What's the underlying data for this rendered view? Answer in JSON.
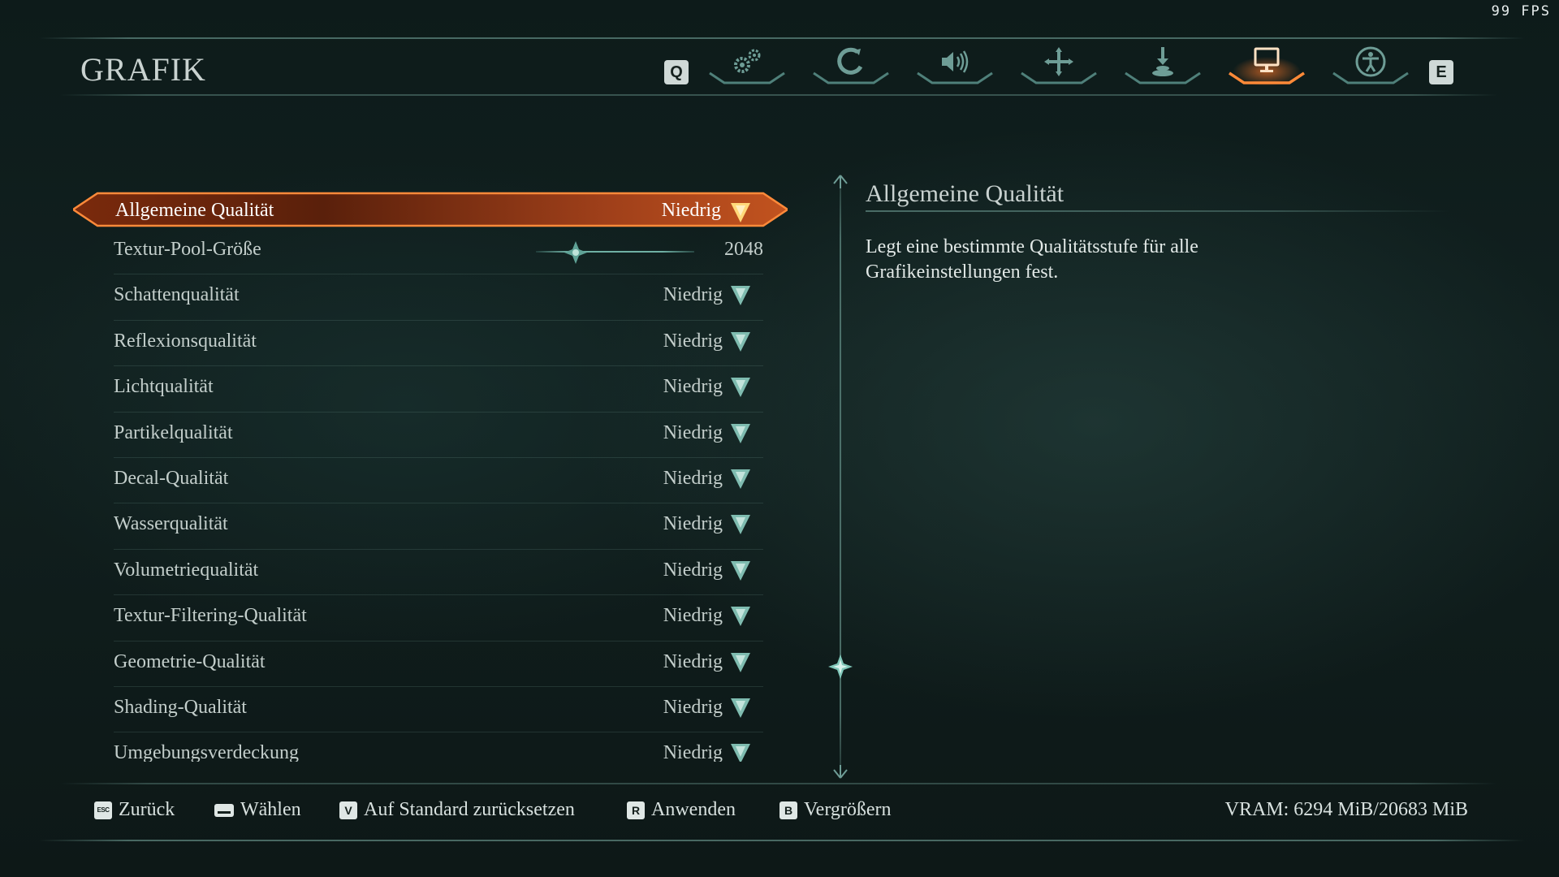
{
  "overlay": {
    "fps": "99 FPS"
  },
  "header": {
    "title": "GRAFIK",
    "prev_tab_key": "Q",
    "next_tab_key": "E",
    "tabs": [
      {
        "icon": "gears-icon",
        "active": false
      },
      {
        "icon": "controller-icon",
        "active": false
      },
      {
        "icon": "speaker-icon",
        "active": false
      },
      {
        "icon": "crosshair-icon",
        "active": false
      },
      {
        "icon": "download-icon",
        "active": false
      },
      {
        "icon": "monitor-icon",
        "active": true
      },
      {
        "icon": "accessibility-icon",
        "active": false
      }
    ]
  },
  "settings": {
    "selected": {
      "label": "Allgemeine Qualität",
      "value": "Niedrig"
    },
    "slider": {
      "label": "Textur-Pool-Größe",
      "value": "2048"
    },
    "rows": [
      {
        "label": "Schattenqualität",
        "value": "Niedrig"
      },
      {
        "label": "Reflexionsqualität",
        "value": "Niedrig"
      },
      {
        "label": "Lichtqualität",
        "value": "Niedrig"
      },
      {
        "label": "Partikelqualität",
        "value": "Niedrig"
      },
      {
        "label": "Decal-Qualität",
        "value": "Niedrig"
      },
      {
        "label": "Wasserqualität",
        "value": "Niedrig"
      },
      {
        "label": "Volumetriequalität",
        "value": "Niedrig"
      },
      {
        "label": "Textur-Filtering-Qualität",
        "value": "Niedrig"
      },
      {
        "label": "Geometrie-Qualität",
        "value": "Niedrig"
      },
      {
        "label": "Shading-Qualität",
        "value": "Niedrig"
      },
      {
        "label": "Umgebungsverdeckung",
        "value": "Niedrig"
      }
    ]
  },
  "description": {
    "title": "Allgemeine Qualität",
    "line1": "Legt eine bestimmte Qualitätsstufe für alle",
    "line2": "Grafikeinstellungen fest."
  },
  "footer": {
    "back": {
      "key": "ESC",
      "label": "Zurück"
    },
    "select": {
      "key": "",
      "label": "Wählen"
    },
    "reset": {
      "key": "V",
      "label": "Auf Standard zurücksetzen"
    },
    "apply": {
      "key": "R",
      "label": "Anwenden"
    },
    "zoom": {
      "key": "B",
      "label": "Vergrößern"
    },
    "vram": "VRAM: 6294 MiB/20683 MiB"
  },
  "colors": {
    "accent_orange": "#e8742a",
    "accent_teal": "#7fbcb0",
    "text": "#c3cecb"
  }
}
